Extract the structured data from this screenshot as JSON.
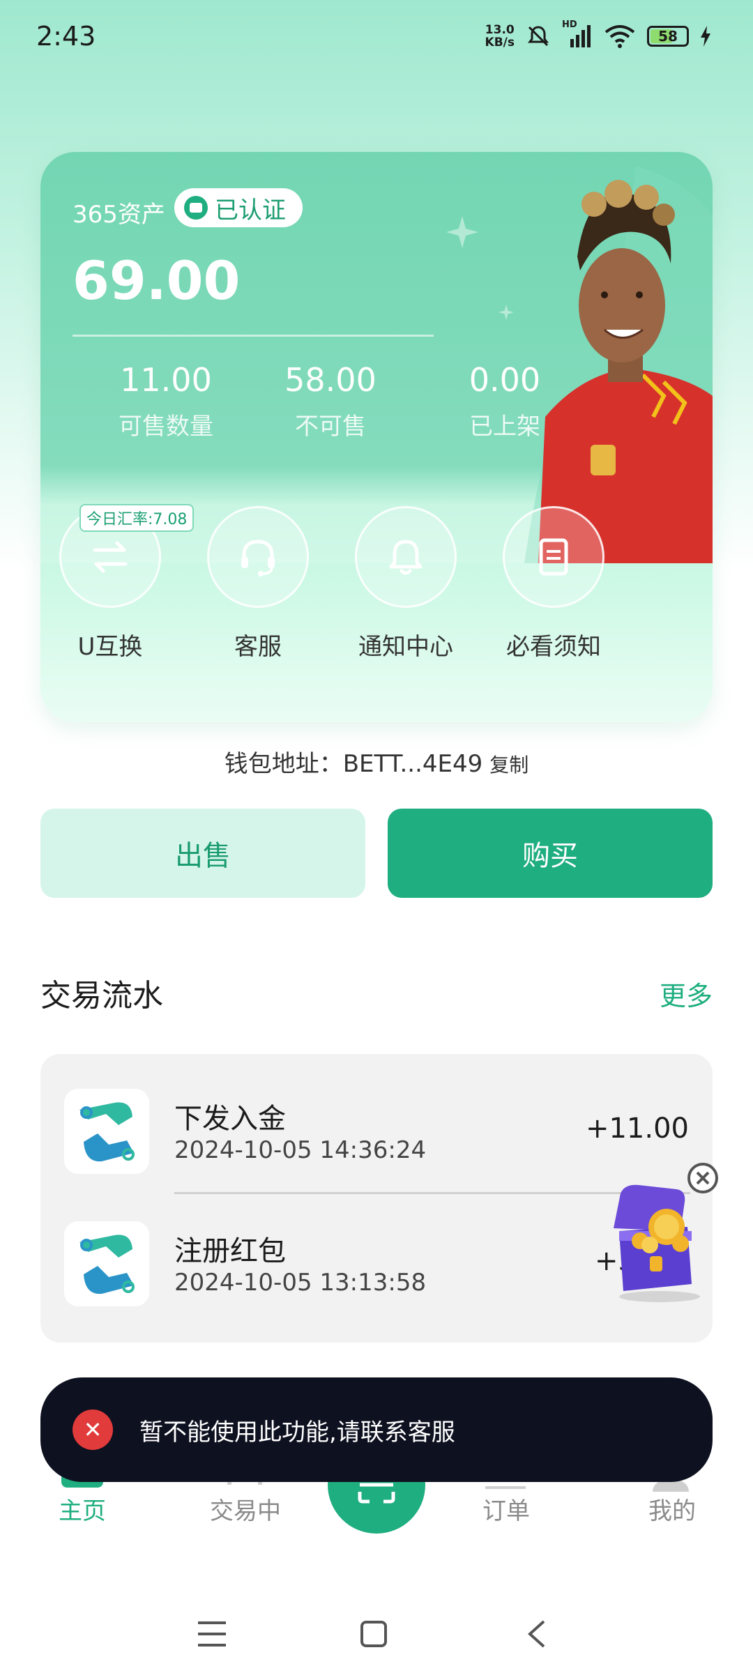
{
  "status_bar": {
    "time": "2:43",
    "net_speed_value": "13.0",
    "net_speed_unit": "KB/s",
    "network_label": "HD",
    "battery": "58"
  },
  "asset_card": {
    "title": "365资产",
    "verified_label": "已认证",
    "total": "69.00",
    "stats": [
      {
        "value": "11.00",
        "label": "可售数量"
      },
      {
        "value": "58.00",
        "label": "不可售"
      },
      {
        "value": "0.00",
        "label": "已上架"
      }
    ],
    "exchange_rate_tag": "今日汇率:7.08",
    "actions": [
      {
        "label": "U互换",
        "icon": "swap-icon"
      },
      {
        "label": "客服",
        "icon": "headset-icon"
      },
      {
        "label": "通知中心",
        "icon": "bell-icon"
      },
      {
        "label": "必看须知",
        "icon": "document-icon"
      }
    ]
  },
  "wallet": {
    "label": "钱包地址：",
    "address": "BETT...4E49",
    "copy": "复制"
  },
  "buttons": {
    "sell": "出售",
    "buy": "购买"
  },
  "transactions": {
    "title": "交易流水",
    "more": "更多",
    "items": [
      {
        "title": "下发入金",
        "date": "2024-10-05 14:36:24",
        "amount": "+11.00"
      },
      {
        "title": "注册红包",
        "date": "2024-10-05 13:13:58",
        "amount": "+5"
      }
    ]
  },
  "toast": {
    "message": "暂不能使用此功能,请联系客服"
  },
  "bottom_nav": {
    "items": [
      {
        "label": "主页",
        "active": true
      },
      {
        "label": "交易中",
        "active": false
      },
      {
        "label": "订单",
        "active": false
      },
      {
        "label": "我的",
        "active": false
      }
    ]
  },
  "colors": {
    "accent": "#1fae7f",
    "card": "#73d6b3",
    "toast_bg": "#0e1120",
    "error": "#e23b3b"
  }
}
